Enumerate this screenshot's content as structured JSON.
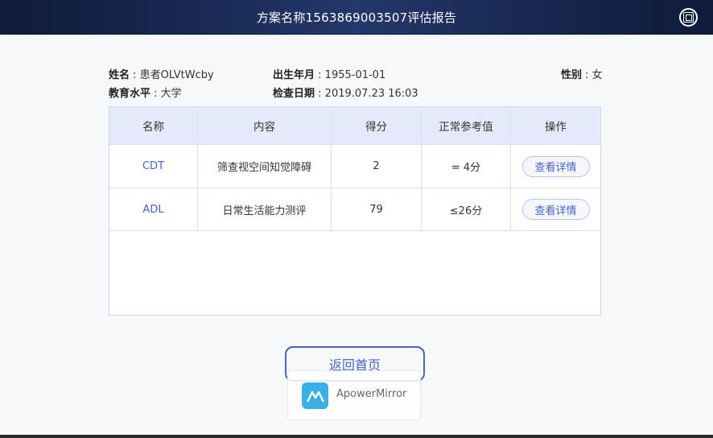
{
  "header": {
    "title": "方案名称1563869003507评估报告",
    "logo_icon": "app-logo-icon"
  },
  "patient": {
    "name_label": "姓名",
    "name_value": "患者OLVtWcby",
    "birth_label": "出生年月",
    "birth_value": "1955-01-01",
    "gender_label": "性别",
    "gender_value": "女",
    "edu_label": "教育水平",
    "edu_value": "大学",
    "date_label": "检查日期",
    "date_value": "2019.07.23  16:03",
    "separator": " : "
  },
  "table": {
    "headers": [
      "名称",
      "内容",
      "得分",
      "正常参考值",
      "操作"
    ],
    "rows": [
      {
        "name": "CDT",
        "content": "筛查视空间知觉障碍",
        "score": "2",
        "reference": "= 4分",
        "action": "查看详情"
      },
      {
        "name": "ADL",
        "content": "日常生活能力测评",
        "score": "79",
        "reference": "≤26分",
        "action": "查看详情"
      }
    ]
  },
  "back_button": "返回首页",
  "watermark": {
    "text": "ApowerMirror",
    "icon": "apowermirror-logo-icon"
  },
  "colors": {
    "accent": "#4a63c8",
    "header_bg": "#1a2a55",
    "table_head_bg": "#e4eafa"
  }
}
